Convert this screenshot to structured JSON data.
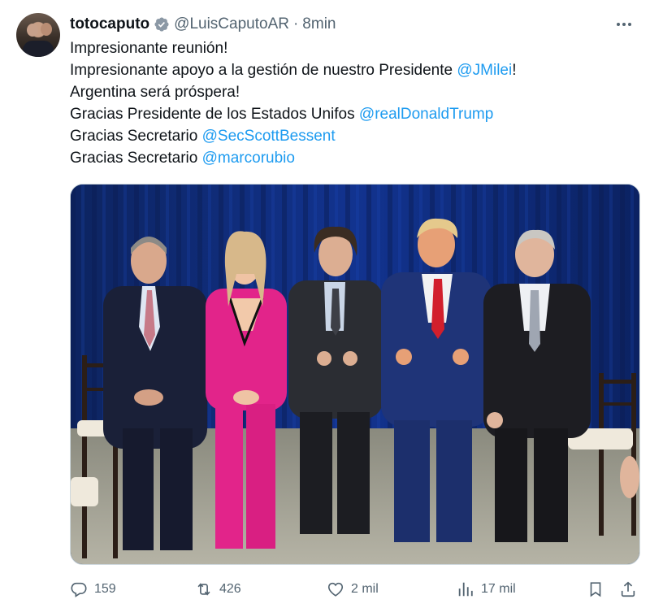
{
  "tweet": {
    "author_name": "totocaputo",
    "handle": "@LuisCaputoAR",
    "separator": "·",
    "time": "8min",
    "lines": [
      {
        "text": "Impresionante reunión!",
        "mention": "",
        "suffix": ""
      },
      {
        "text": "Impresionante apoyo a la gestión de nuestro Presidente ",
        "mention": "@JMilei",
        "suffix": "!"
      },
      {
        "text": "Argentina será próspera!",
        "mention": "",
        "suffix": ""
      },
      {
        "text": "Gracias Presidente de los Estados Unifos ",
        "mention": "@realDonaldTrump",
        "suffix": ""
      },
      {
        "text": "Gracias Secretario ",
        "mention": "@SecScottBessent",
        "suffix": ""
      },
      {
        "text": "Gracias Secretario ",
        "mention": "@marcorubio",
        "suffix": ""
      }
    ]
  },
  "metrics": {
    "replies": "159",
    "reposts": "426",
    "likes": "2 mil",
    "views": "17 mil"
  },
  "icons": {
    "verified": "verified-badge-icon",
    "more": "more-dots-icon",
    "reply": "reply-icon",
    "repost": "repost-icon",
    "like": "heart-icon",
    "views": "views-chart-icon",
    "bookmark": "bookmark-icon",
    "share": "share-icon"
  },
  "colors": {
    "accent": "#1d9bf0",
    "text": "#0f1419",
    "muted": "#536471"
  }
}
